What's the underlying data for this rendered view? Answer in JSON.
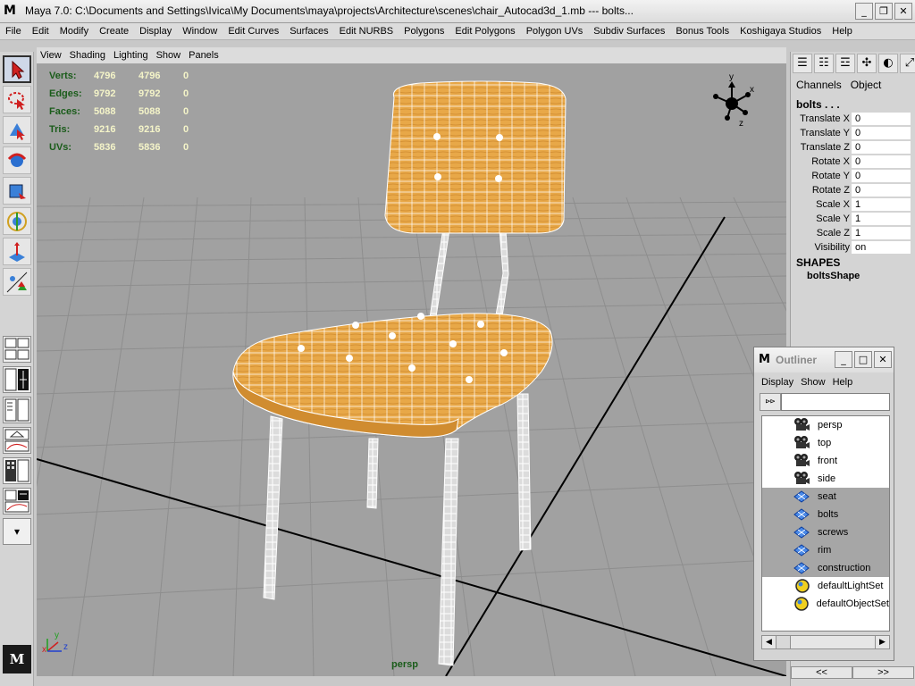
{
  "window": {
    "title": "Maya 7.0: C:\\Documents and Settings\\Ivica\\My Documents\\maya\\projects\\Architecture\\scenes\\chair_Autocad3d_1.mb   ---   bolts...",
    "minimize_glyph": "_",
    "maximize_glyph": "❐",
    "close_glyph": "✕"
  },
  "menubar": {
    "items": [
      "File",
      "Edit",
      "Modify",
      "Create",
      "Display",
      "Window",
      "Edit Curves",
      "Surfaces",
      "Edit NURBS",
      "Polygons",
      "Edit Polygons",
      "Polygon UVs",
      "Subdiv Surfaces",
      "Bonus Tools",
      "Koshigaya Studios",
      "Help"
    ]
  },
  "toolbox": {
    "tools": [
      "select-tool-icon",
      "lasso-tool-icon",
      "paint-select-tool-icon",
      "move-tool-icon",
      "rotate-tool-icon",
      "scale-tool-icon",
      "universal-manipulator-icon",
      "show-manipulator-icon"
    ],
    "layout_more_glyph": "▾"
  },
  "panel": {
    "menu": [
      "View",
      "Shading",
      "Lighting",
      "Show",
      "Panels"
    ],
    "camera": "persp"
  },
  "hud": {
    "rows": [
      {
        "label": "Verts:",
        "a": "4796",
        "b": "4796",
        "c": "0"
      },
      {
        "label": "Edges:",
        "a": "9792",
        "b": "9792",
        "c": "0"
      },
      {
        "label": "Faces:",
        "a": "5088",
        "b": "5088",
        "c": "0"
      },
      {
        "label": "Tris:",
        "a": "9216",
        "b": "9216",
        "c": "0"
      },
      {
        "label": "UVs:",
        "a": "5836",
        "b": "5836",
        "c": "0"
      }
    ]
  },
  "view_cube": {
    "y_label": "y",
    "x_label": "x",
    "z_label": "z"
  },
  "axis_indicator": {
    "x": "x",
    "y": "y",
    "z": "z"
  },
  "channel_box": {
    "tabs": [
      "Channels",
      "Object"
    ],
    "object_name": "bolts . . .",
    "attributes": [
      {
        "name": "Translate X",
        "value": "0"
      },
      {
        "name": "Translate Y",
        "value": "0"
      },
      {
        "name": "Translate Z",
        "value": "0"
      },
      {
        "name": "Rotate X",
        "value": "0"
      },
      {
        "name": "Rotate Y",
        "value": "0"
      },
      {
        "name": "Rotate Z",
        "value": "0"
      },
      {
        "name": "Scale X",
        "value": "1"
      },
      {
        "name": "Scale Y",
        "value": "1"
      },
      {
        "name": "Scale Z",
        "value": "1"
      },
      {
        "name": "Visibility",
        "value": "on"
      }
    ],
    "shapes_header": "SHAPES",
    "shape_name": "boltsShape",
    "scroll_left": "<<",
    "scroll_right": ">>"
  },
  "outliner": {
    "title": "Outliner",
    "menu": [
      "Display",
      "Show",
      "Help"
    ],
    "search_icon": "⊳⊳",
    "items": [
      {
        "label": "persp",
        "icon": "camera-icon",
        "selected": false
      },
      {
        "label": "top",
        "icon": "camera-icon",
        "selected": false
      },
      {
        "label": "front",
        "icon": "camera-icon",
        "selected": false
      },
      {
        "label": "side",
        "icon": "camera-icon",
        "selected": false
      },
      {
        "label": "seat",
        "icon": "mesh-icon",
        "selected": true
      },
      {
        "label": "bolts",
        "icon": "mesh-icon",
        "selected": true
      },
      {
        "label": "screws",
        "icon": "mesh-icon",
        "selected": true
      },
      {
        "label": "rim",
        "icon": "mesh-icon",
        "selected": true
      },
      {
        "label": "construction",
        "icon": "mesh-icon",
        "selected": true
      },
      {
        "label": "defaultLightSet",
        "icon": "set-icon",
        "selected": false
      },
      {
        "label": "defaultObjectSet",
        "icon": "set-icon",
        "selected": false
      }
    ],
    "scroll_left": "◀",
    "scroll_right": "▶"
  },
  "colors": {
    "viewport_bg": "#a1a1a1",
    "grid": "#8e8e8e",
    "wood": "#e8a848",
    "hud_label": "#1a5c1a",
    "selected_row": "#a6a6a6"
  }
}
